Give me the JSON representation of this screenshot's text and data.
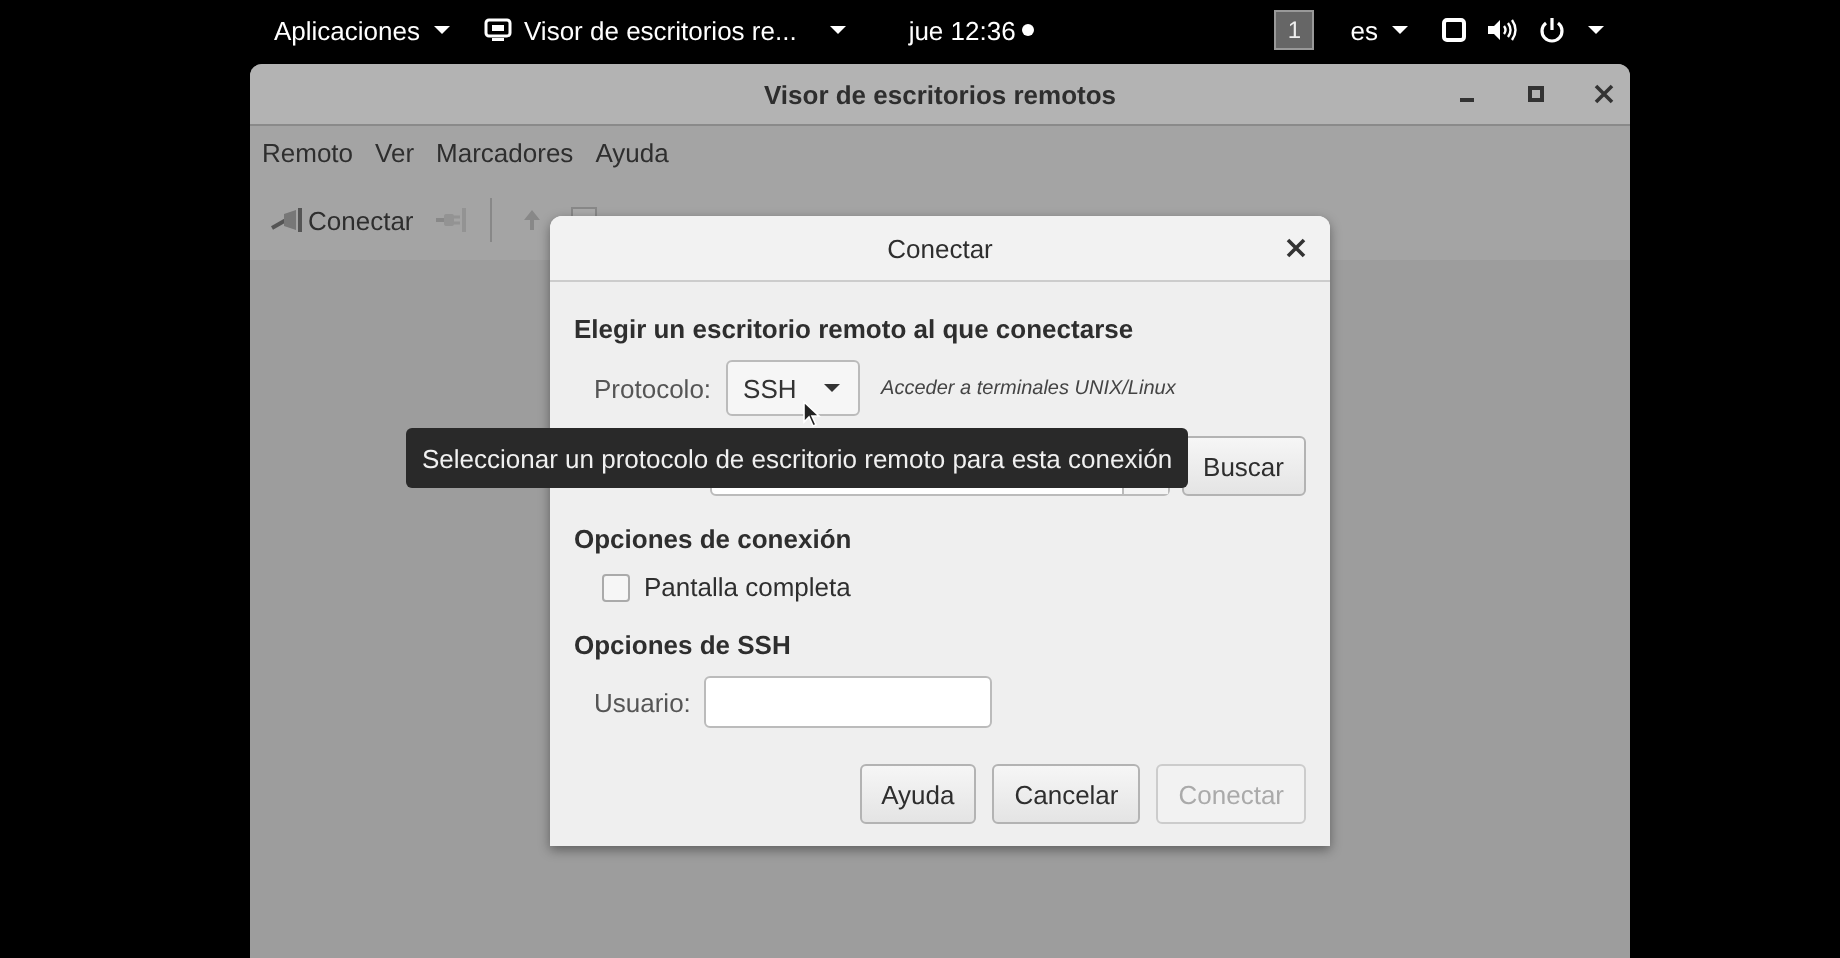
{
  "top_bar": {
    "activities": "Aplicaciones",
    "app_menu": "Visor de escritorios re...",
    "clock": "jue 12:36",
    "workspace": "1",
    "keyboard": "es"
  },
  "window": {
    "title": "Visor de escritorios remotos",
    "menu": [
      "Remoto",
      "Ver",
      "Marcadores",
      "Ayuda"
    ],
    "toolbar": [
      {
        "kind": "connect",
        "label": "Conectar",
        "disabled": false
      },
      {
        "kind": "disconnect",
        "disabled": true
      },
      {
        "kind": "separator"
      },
      {
        "kind": "up"
      },
      {
        "kind": "screen"
      }
    ]
  },
  "dialog": {
    "title": "Conectar",
    "heading": "Elegir un escritorio remoto al que conectarse",
    "protocol_label": "Protocolo:",
    "protocol": "SSH",
    "protocol_hint": "Acceder a terminales UNIX/Linux",
    "search_button": "Buscar",
    "connection_heading": "Opciones de conexión",
    "options": [
      {
        "label": "Pantalla completa",
        "checked": false
      }
    ],
    "ssh_heading": "Opciones de SSH",
    "user_label": "Usuario:",
    "buttons": [
      {
        "label": "Ayuda",
        "disabled": false
      },
      {
        "label": "Cancelar",
        "disabled": false
      },
      {
        "label": "Conectar",
        "disabled": true
      }
    ]
  },
  "tooltip": "Seleccionar un protocolo de escritorio remoto para esta conexión"
}
